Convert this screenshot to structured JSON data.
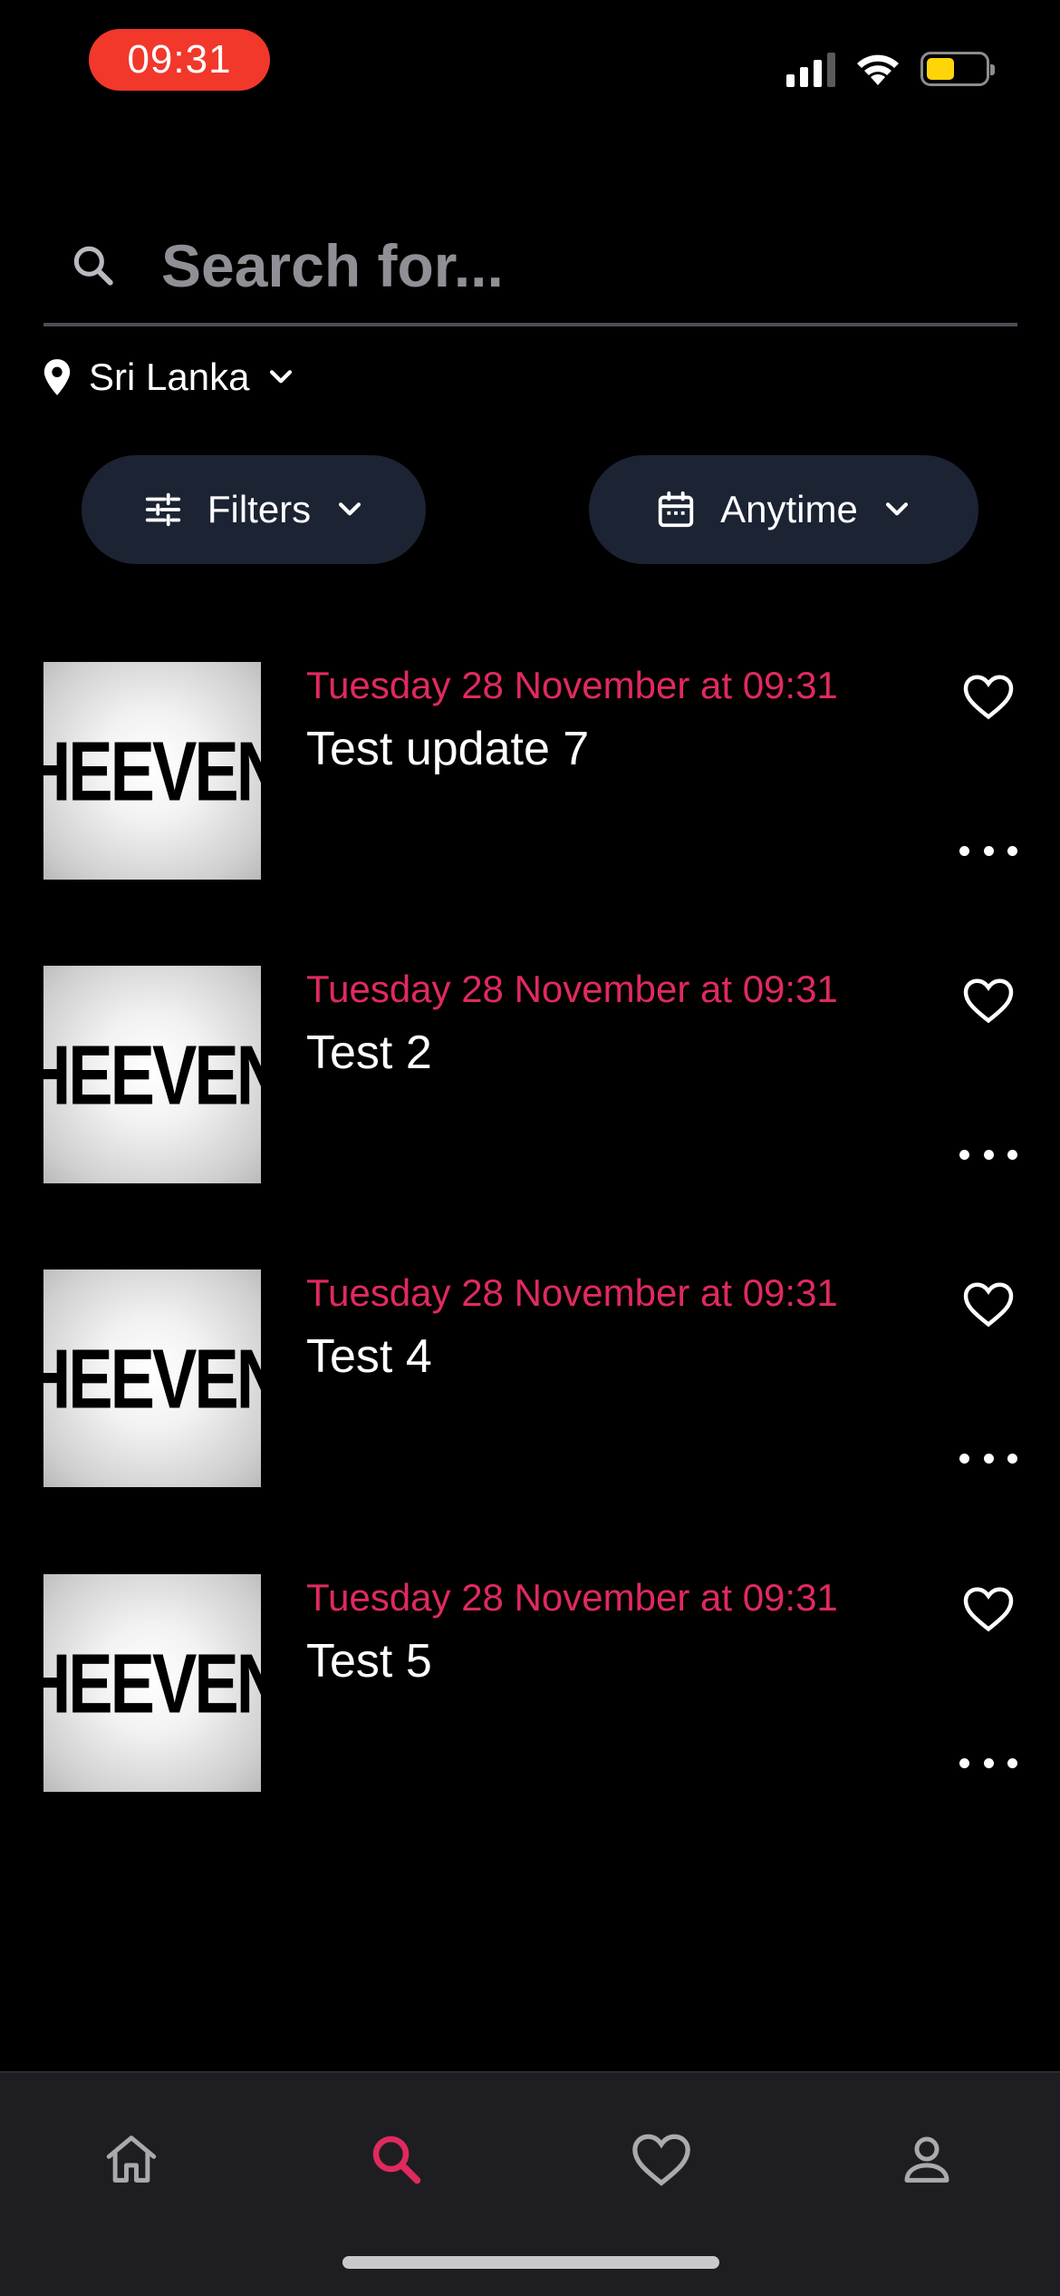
{
  "status_bar": {
    "time": "09:31",
    "accent": "#f2372b",
    "battery_color": "#ffd50a"
  },
  "search": {
    "placeholder": "Search for...",
    "icon": "search-icon"
  },
  "location": {
    "label": "Sri Lanka",
    "icon": "map-pin-icon"
  },
  "filters": {
    "filters_label": "Filters",
    "anytime_label": "Anytime"
  },
  "colors": {
    "date_text": "#e02a5e",
    "nav_active": "#e02a5e",
    "pill_bg": "#1c2333"
  },
  "events": [
    {
      "date": "Tuesday 28 November at 09:31",
      "title": "Test update 7",
      "image_text": "THEEVENT"
    },
    {
      "date": "Tuesday 28 November at 09:31",
      "title": "Test 2",
      "image_text": "THEEVENT"
    },
    {
      "date": "Tuesday 28 November at 09:31",
      "title": "Test 4",
      "image_text": "THEEVENT"
    },
    {
      "date": "Tuesday 28 November at 09:31",
      "title": "Test 5",
      "image_text": "THEEVENT"
    }
  ],
  "bottom_nav": {
    "items": [
      {
        "icon": "home-icon",
        "active": false
      },
      {
        "icon": "search-icon",
        "active": true
      },
      {
        "icon": "heart-icon",
        "active": false
      },
      {
        "icon": "profile-icon",
        "active": false
      }
    ]
  }
}
